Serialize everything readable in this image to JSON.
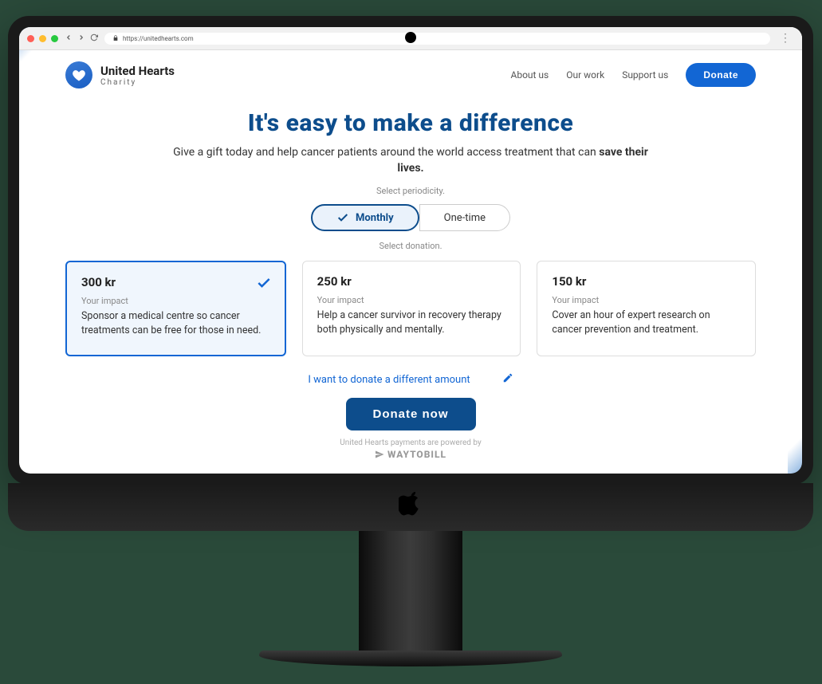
{
  "browser": {
    "url": "https://unitedhearts.com"
  },
  "brand": {
    "name": "United Hearts",
    "tagline": "Charity"
  },
  "nav": {
    "about": "About us",
    "work": "Our work",
    "support": "Support us",
    "donate": "Donate"
  },
  "hero": {
    "title": "It's easy to make a difference",
    "tagline_pre": "Give a gift today and help cancer patients around the world access treatment that can ",
    "tagline_bold": "save their lives."
  },
  "periodicity": {
    "label": "Select periodicity.",
    "monthly": "Monthly",
    "onetime": "One-time"
  },
  "donation": {
    "label": "Select donation.",
    "impact_label": "Your impact",
    "options": [
      {
        "amount": "300 kr",
        "desc": "Sponsor a  medical centre so cancer treatments can be free for those in need.",
        "selected": true
      },
      {
        "amount": "250 kr",
        "desc": "Help a cancer survivor in recovery therapy both physically and mentally.",
        "selected": false
      },
      {
        "amount": "150 kr",
        "desc": "Cover an hour of expert research on cancer prevention and treatment.",
        "selected": false
      }
    ],
    "different_amount": "I want to donate a different amount",
    "donate_now": "Donate now"
  },
  "footer": {
    "powered": "United Hearts payments are powered by",
    "provider": "WAYTOBILL"
  }
}
